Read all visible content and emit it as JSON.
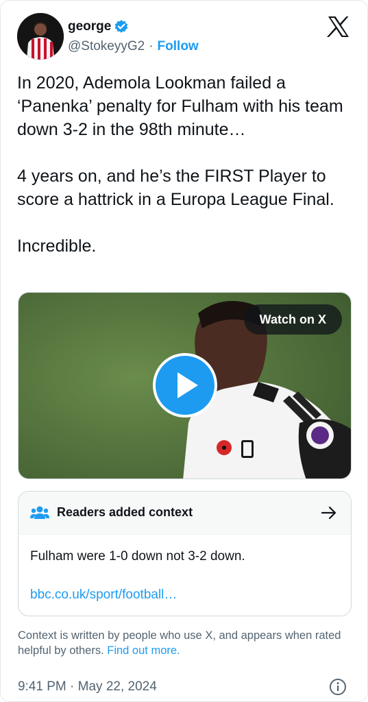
{
  "author": {
    "display_name": "george",
    "handle": "@StokeyyG2",
    "follow_label": "Follow",
    "verified_icon": "verified-badge-icon",
    "separator": "·"
  },
  "brand": {
    "logo_icon": "x-logo-icon"
  },
  "tweet": {
    "text": "In 2020, Ademola Lookman failed a ‘Panenka’ penalty for Fulham with his team down 3-2 in the 98th minute…\n\n4 years on, and he’s the FIRST Player to score a hattrick in a Europa League Final.\n\nIncredible."
  },
  "media": {
    "watch_label": "Watch on X",
    "play_icon": "play-icon"
  },
  "context": {
    "title": "Readers added context",
    "body": "Fulham were 1-0 down not 3-2 down.",
    "link": "bbc.co.uk/sport/football…",
    "header_icon": "people-icon",
    "arrow_icon": "arrow-right-icon"
  },
  "footnote": {
    "text": "Context is written by people who use X, and appears when rated helpful by others. ",
    "link": "Find out more."
  },
  "meta": {
    "timestamp": "9:41 PM · May 22, 2024",
    "info_icon": "info-icon"
  },
  "colors": {
    "accent": "#1d9bf0",
    "text": "#0f1419",
    "muted": "#536471",
    "border": "#cfd9de"
  }
}
